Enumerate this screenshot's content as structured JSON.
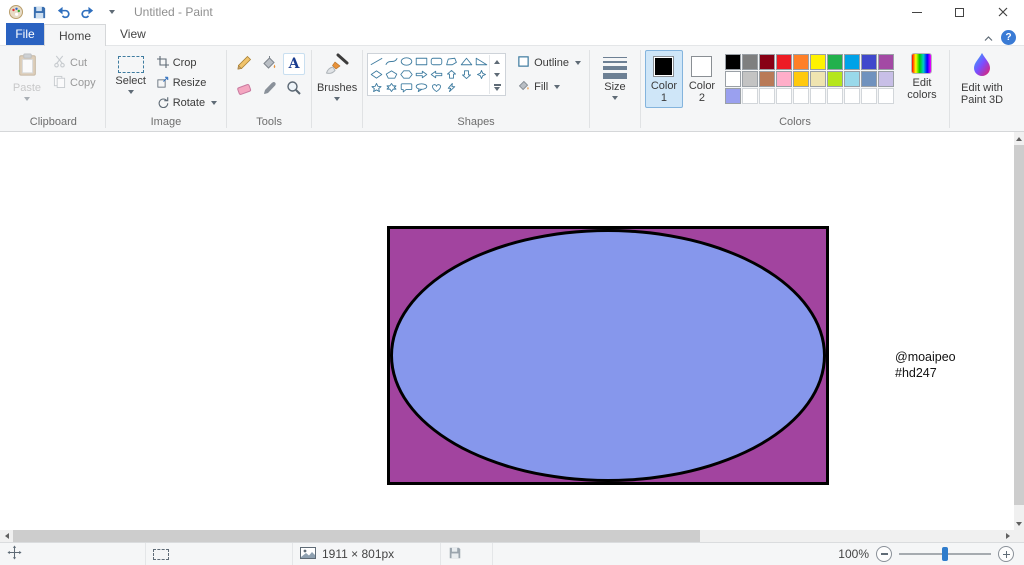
{
  "theme": {
    "file_tab": "#2a62c1",
    "help_icon": "#3a7bd5",
    "zoom_thumb": "#2f7ccc",
    "shape_stroke_teal": "#3f7ca0"
  },
  "window": {
    "title": "Untitled - Paint"
  },
  "tabs": {
    "file": "File",
    "home": "Home",
    "view": "View"
  },
  "ribbon": {
    "clipboard": {
      "label": "Clipboard",
      "paste": "Paste",
      "cut": "Cut",
      "copy": "Copy"
    },
    "image": {
      "label": "Image",
      "select": "Select",
      "crop": "Crop",
      "resize": "Resize",
      "rotate": "Rotate"
    },
    "tools": {
      "label": "Tools",
      "items": [
        "pencil",
        "fill-with-color",
        "text",
        "eraser",
        "color-picker",
        "magnifier"
      ]
    },
    "brushes": {
      "label": "Brushes"
    },
    "shapes": {
      "label": "Shapes",
      "outline": "Outline",
      "fill": "Fill",
      "items": [
        "line",
        "curve",
        "oval",
        "rectangle",
        "rounded-rectangle",
        "polygon",
        "triangle",
        "right-triangle",
        "diamond",
        "pentagon",
        "hexagon",
        "right-arrow",
        "left-arrow",
        "up-arrow",
        "down-arrow",
        "four-point-star",
        "five-point-star",
        "six-point-star",
        "rounded-callout",
        "oval-callout",
        "heart",
        "lightning"
      ]
    },
    "size": {
      "label": "Size"
    },
    "colors": {
      "label": "Colors",
      "color1_label": "Color 1",
      "color1_value": "#000000",
      "color2_label": "Color 2",
      "color2_value": "#ffffff",
      "edit_colors": "Edit colors",
      "palette_row1": [
        "#000000",
        "#7f7f7f",
        "#880015",
        "#ed1c24",
        "#ff7f27",
        "#fff200",
        "#22b14c",
        "#00a2e8",
        "#3f48cc",
        "#a349a4"
      ],
      "palette_row2": [
        "#ffffff",
        "#c3c3c3",
        "#b97a57",
        "#ffaec9",
        "#ffc90e",
        "#efe4b0",
        "#b5e61d",
        "#99d9ea",
        "#7092be",
        "#c8bfe7"
      ],
      "palette_row3": [
        "#9aa0ef",
        null,
        null,
        null,
        null,
        null,
        null,
        null,
        null,
        null
      ]
    },
    "paint3d": {
      "label": "Edit with Paint 3D"
    }
  },
  "canvas": {
    "shape_rect_fill": "#a2449f",
    "shape_ellipse_fill": "#8697ec",
    "shape_stroke": "#000000",
    "annotation_line1": "@moaipeo",
    "annotation_line2": "#hd247"
  },
  "statusbar": {
    "image_size": "1911 × 801px",
    "zoom": "100%"
  }
}
